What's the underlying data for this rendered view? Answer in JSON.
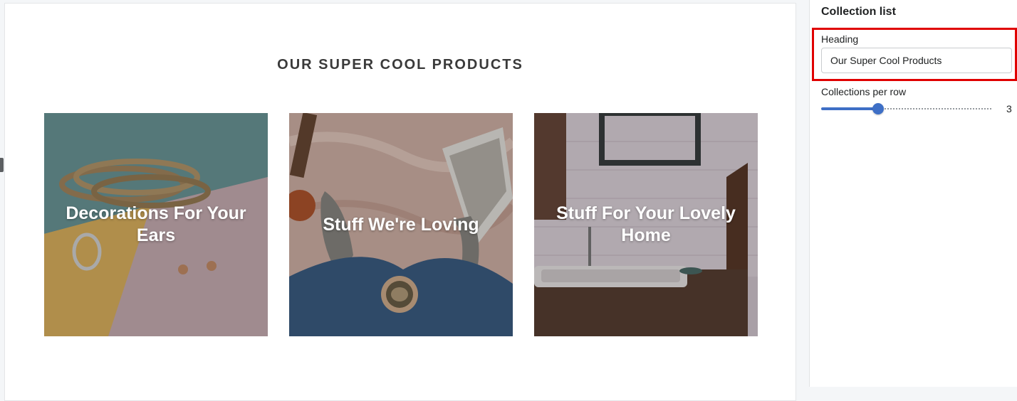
{
  "preview": {
    "heading": "OUR SUPER COOL PRODUCTS",
    "collections": [
      {
        "title": "Decorations For Your Ears",
        "image": "jewelry-bracelets-earrings-photo"
      },
      {
        "title": "Stuff We're Loving",
        "image": "cozy-socks-coffee-mug-photo"
      },
      {
        "title": "Stuff For Your Lovely Home",
        "image": "bathroom-sink-interior-photo"
      }
    ]
  },
  "panel": {
    "title": "Collection list",
    "heading_field": {
      "label": "Heading",
      "value": "Our Super Cool Products"
    },
    "collections_per_row": {
      "label": "Collections per row",
      "value": 3,
      "min": 2,
      "max": 5,
      "value_text": "3"
    },
    "highlight_color": "#e00000",
    "accent_color": "#3e6fc6"
  }
}
